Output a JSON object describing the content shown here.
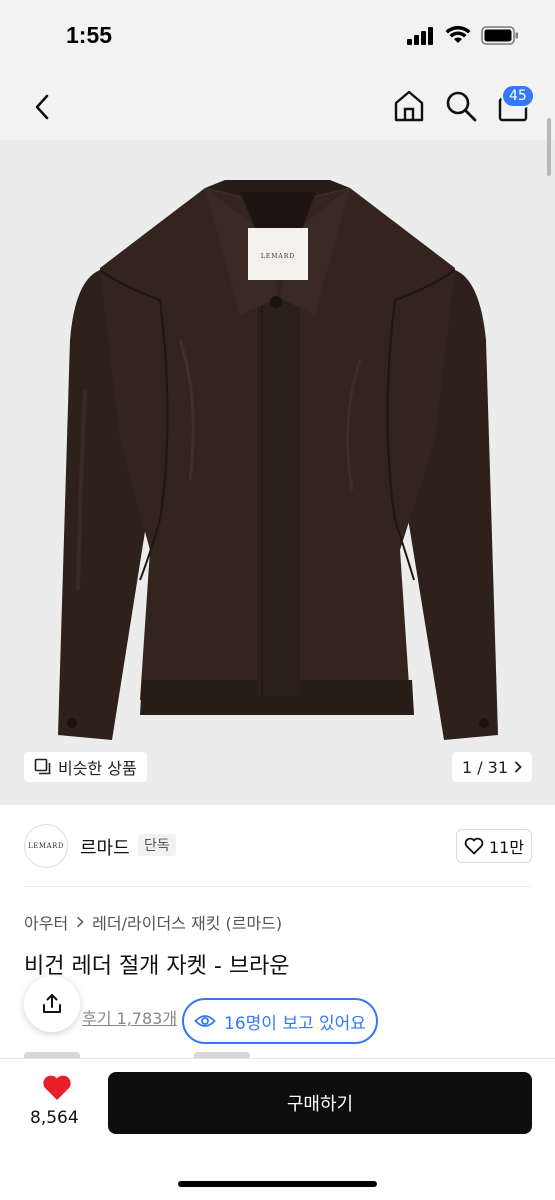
{
  "status_bar": {
    "time": "1:55",
    "battery_icon": "battery-icon",
    "wifi_icon": "wifi-icon",
    "signal_icon": "signal-icon"
  },
  "nav": {
    "back_icon": "chevron-left-icon",
    "home_icon": "home-icon",
    "search_icon": "search-icon",
    "cart_icon": "shopping-bag-icon",
    "cart_badge": "45"
  },
  "image": {
    "label_tag": "LEMARD",
    "similar_label": "비슷한 상품",
    "counter": "1 / 31"
  },
  "brand": {
    "logo_text": "LEMARD",
    "name": "르마드",
    "tag": "단독",
    "like_count": "11만"
  },
  "product": {
    "breadcrumb": [
      "아우터",
      "레더/라이더스 재킷 (르마드)"
    ],
    "title": "비건 레더 절개 자켓 - 브라운",
    "review_link": "후기 1,783개",
    "viewers": "16명이 보고 있어요"
  },
  "bottom": {
    "wish_count": "8,564",
    "buy_label": "구매하기"
  },
  "colors": {
    "accent": "#3478f6",
    "heart": "#e8202a",
    "buy_bg": "#0d0d0d",
    "jacket": "#2e211c"
  }
}
